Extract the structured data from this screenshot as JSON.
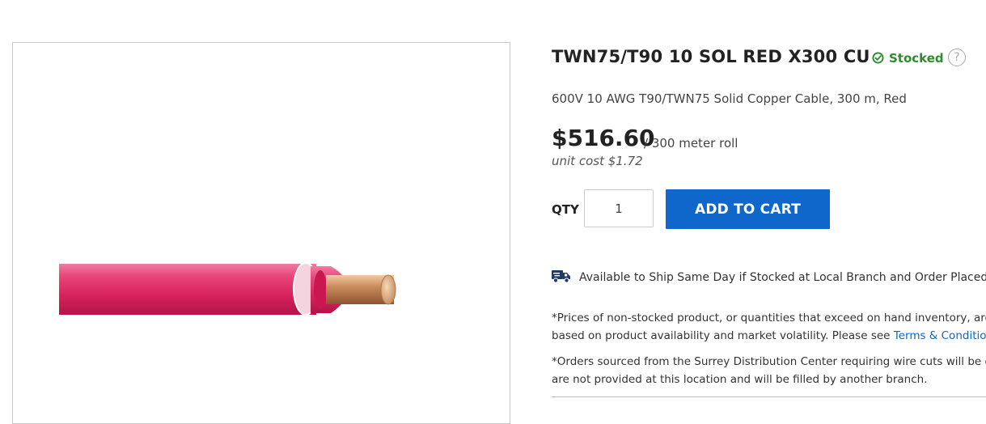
{
  "product": {
    "title": "TWN75/T90 10 SOL RED X300 CU",
    "stock_status": "Stocked",
    "help_glyph": "?",
    "description": "600V 10 AWG T90/TWN75 Solid Copper Cable, 300 m, Red",
    "price": "$516.60",
    "price_unit": "/ 300 meter roll",
    "unit_cost": "unit cost $1.72",
    "image_alt": "Red solid copper cable"
  },
  "purchase": {
    "qty_label": "QTY",
    "qty_value": "1",
    "add_to_cart_label": "ADD TO CART"
  },
  "shipping": {
    "same_day_text": "Available to Ship Same Day if Stocked at Local Branch and Order Placed befor"
  },
  "notices": {
    "pricing_line1": "*Prices of non-stocked product, or quantities that exceed on hand inventory, are su",
    "pricing_line2_prefix": "based on product availability and market volatility. Please see ",
    "terms_link": "Terms & Conditions",
    "pricing_line2_suffix": " f",
    "surrey_line1": "*Orders sourced from the Surrey Distribution Center requiring wire cuts will be del",
    "surrey_line2": "are not provided at this location and will be filled by another branch."
  },
  "colors": {
    "accent_button": "#0f67cc",
    "stock_green": "#2e8b2e",
    "cable_red": "#d9235f",
    "link_blue": "#1565c0"
  },
  "icons": {
    "stock": "check-circle-icon",
    "help": "question-circle-icon",
    "shipping": "truck-icon"
  }
}
